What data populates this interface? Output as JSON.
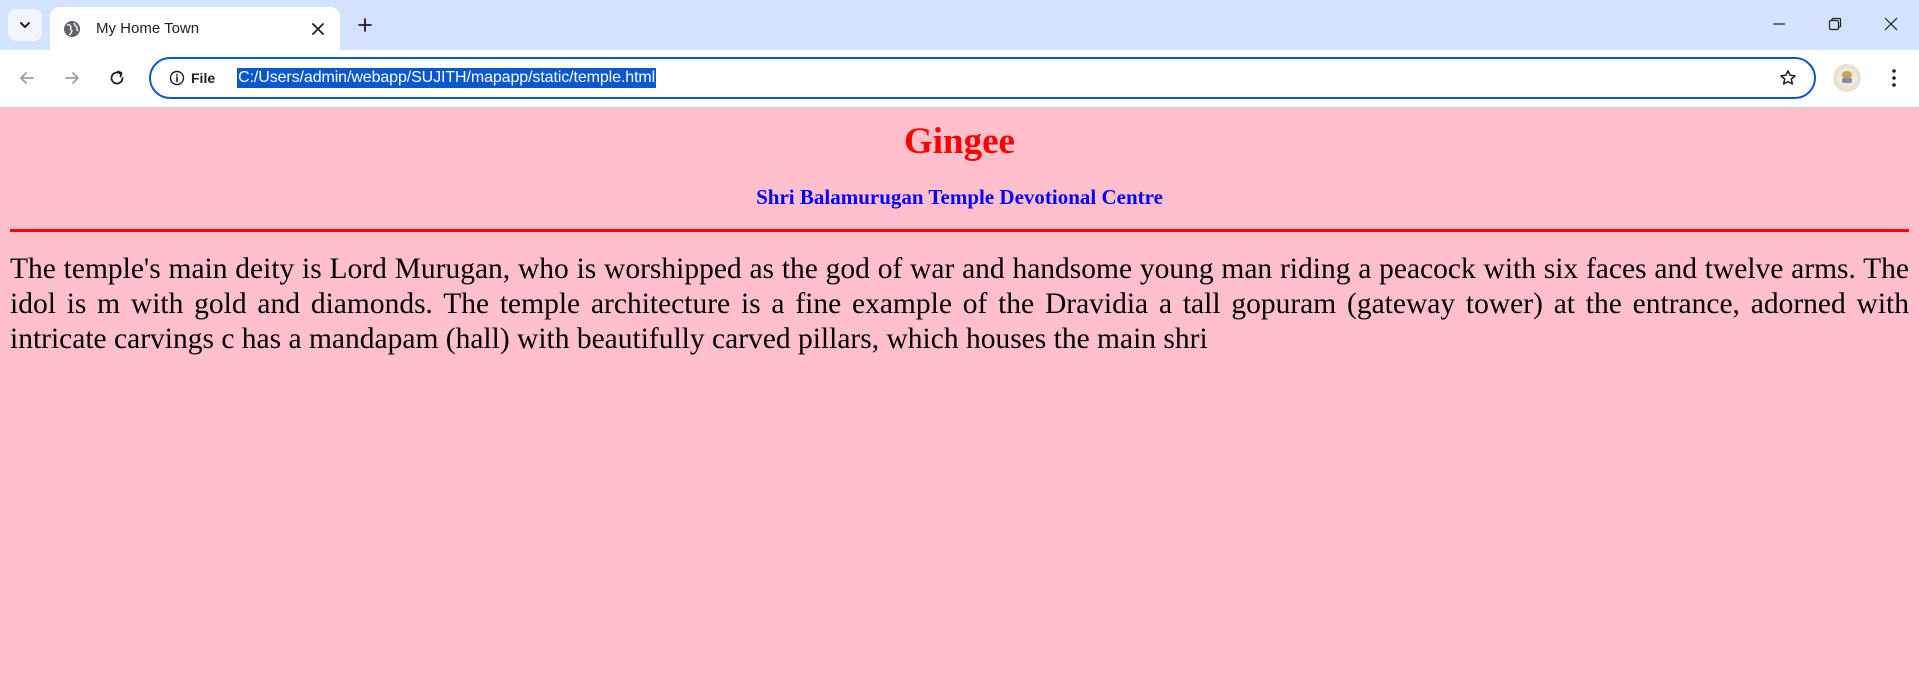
{
  "browser": {
    "tab": {
      "title": "My Home Town",
      "favicon": "globe-icon"
    },
    "toolbar": {
      "site_info_label": "File",
      "url": "C:/Users/admin/webapp/SUJITH/mapapp/static/temple.html"
    },
    "colors": {
      "tabstrip": "#d3e3fd",
      "omnibox_border": "#0b57d0",
      "url_selection": "#0b57d0"
    }
  },
  "page": {
    "title": "Gingee",
    "subtitle": "Shri Balamurugan Temple Devotional Centre",
    "body": "The temple's main deity is Lord Murugan, who is worshipped as the god of war and handsome young man riding a peacock with six faces and twelve arms. The idol is m with gold and diamonds. The temple architecture is a fine example of the Dravidia a tall gopuram (gateway tower) at the entrance, adorned with intricate carvings c has a mandapam (hall) with beautifully carved pillars, which houses the main shri",
    "colors": {
      "background": "#ffc0cb",
      "title": "#ff0000",
      "subtitle": "#0000ff",
      "rule": "#ff0000"
    }
  }
}
